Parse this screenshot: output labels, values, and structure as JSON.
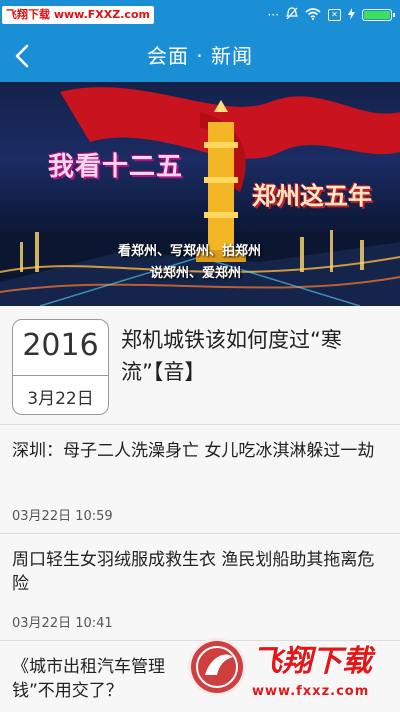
{
  "status_bar": {
    "watermark": "飞翔下载 www.FXXZ.com",
    "icons": [
      "more-icon",
      "mute-icon",
      "wifi-icon",
      "sim-disabled-icon",
      "charging-icon",
      "battery-icon"
    ],
    "dots": "···",
    "battery_level": 1.0
  },
  "header": {
    "title": "会面 · 新闻"
  },
  "banner": {
    "headline_left": "我看十二五",
    "headline_right": "郑州这五年",
    "slogan_line1": "看郑州、写郑州、拍郑州",
    "slogan_line2": "说郑州、爱郑州"
  },
  "featured": {
    "year": "2016",
    "day": "3月22日",
    "title": "郑机城铁该如何度过“寒流”【音】"
  },
  "news": [
    {
      "title": "深圳：母子二人洗澡身亡 女儿吃冰淇淋躲过一劫",
      "time": "03月22日 10:59"
    },
    {
      "title": "周口轻生女羽绒服成救生衣 渔民划船助其拖离危险",
      "time": "03月22日 10:41"
    },
    {
      "title": "《城市出租汽车管理",
      "title_tail": "钱”不用交了？",
      "time": ""
    }
  ],
  "watermark_bottom": {
    "logo": "飞翔下载",
    "url": "www.fxxz.com"
  },
  "colors": {
    "primary": "#1a8fd6",
    "battery": "#3de05a",
    "watermark_red": "#e21818"
  }
}
